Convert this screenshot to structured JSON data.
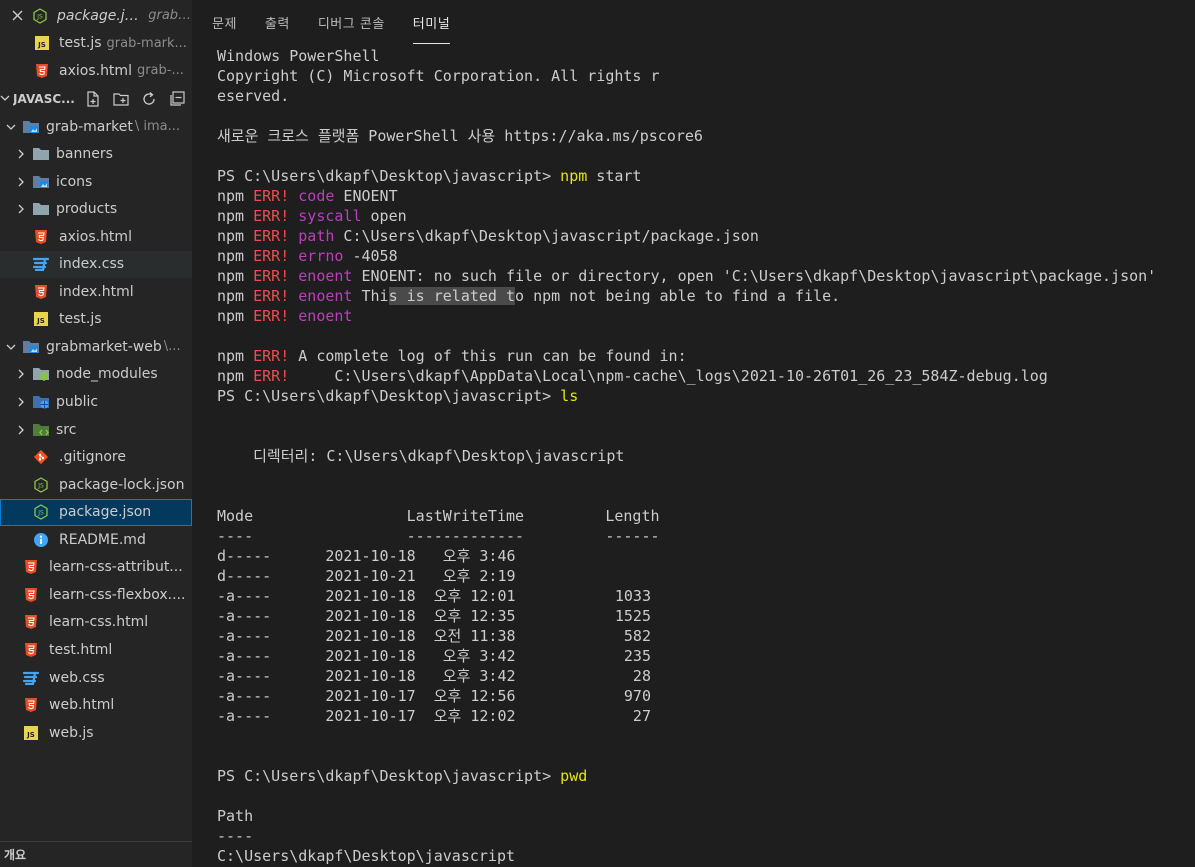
{
  "explorer": {
    "open_editors": [
      {
        "name": "package.json",
        "desc": "grab-...",
        "icon": "node-icon",
        "active": true
      },
      {
        "name": "test.js",
        "desc": "grab-mark...",
        "icon": "js-icon"
      },
      {
        "name": "axios.html",
        "desc": "grab-...",
        "icon": "html-icon"
      }
    ],
    "section_title": "JAVASC...",
    "tree": [
      {
        "name": "grab-market",
        "desc": "\\ ima...",
        "level": 0,
        "type": "folder",
        "icon": "folder-image-icon",
        "expanded": true
      },
      {
        "name": "banners",
        "level": 1,
        "type": "folder",
        "icon": "folder-icon"
      },
      {
        "name": "icons",
        "level": 1,
        "type": "folder",
        "icon": "folder-image-icon"
      },
      {
        "name": "products",
        "level": 1,
        "type": "folder",
        "icon": "folder-icon"
      },
      {
        "name": "axios.html",
        "level": 1,
        "type": "file",
        "icon": "html-icon"
      },
      {
        "name": "index.css",
        "level": 1,
        "type": "file",
        "icon": "css-icon"
      },
      {
        "name": "index.html",
        "level": 1,
        "type": "file",
        "icon": "html-icon"
      },
      {
        "name": "test.js",
        "level": 1,
        "type": "file",
        "icon": "js-icon"
      },
      {
        "name": "grabmarket-web",
        "desc": "\\...",
        "level": 0,
        "type": "folder",
        "icon": "folder-image-icon",
        "expanded": true
      },
      {
        "name": "node_modules",
        "level": 1,
        "type": "folder",
        "icon": "folder-node-icon"
      },
      {
        "name": "public",
        "level": 1,
        "type": "folder",
        "icon": "folder-public-icon"
      },
      {
        "name": "src",
        "level": 1,
        "type": "folder",
        "icon": "folder-src-icon"
      },
      {
        "name": ".gitignore",
        "level": 1,
        "type": "file",
        "icon": "git-icon"
      },
      {
        "name": "package-lock.json",
        "level": 1,
        "type": "file",
        "icon": "node-icon"
      },
      {
        "name": "package.json",
        "level": 1,
        "type": "file",
        "icon": "node-icon",
        "selected": true
      },
      {
        "name": "README.md",
        "level": 1,
        "type": "file",
        "icon": "info-icon"
      },
      {
        "name": "learn-css-attribut...",
        "level": 0,
        "type": "file",
        "icon": "html-icon"
      },
      {
        "name": "learn-css-flexbox....",
        "level": 0,
        "type": "file",
        "icon": "html-icon"
      },
      {
        "name": "learn-css.html",
        "level": 0,
        "type": "file",
        "icon": "html-icon"
      },
      {
        "name": "test.html",
        "level": 0,
        "type": "file",
        "icon": "html-icon"
      },
      {
        "name": "web.css",
        "level": 0,
        "type": "file",
        "icon": "css-icon"
      },
      {
        "name": "web.html",
        "level": 0,
        "type": "file",
        "icon": "html-icon"
      },
      {
        "name": "web.js",
        "level": 0,
        "type": "file",
        "icon": "js-icon"
      }
    ],
    "outline_title": "개요",
    "colors": {
      "html": "#e44d26",
      "css": "#42a5f5",
      "js": "#e8d44d",
      "node": "#8bc34a",
      "git": "#f4511e",
      "info": "#42a5f5",
      "folder": "#90a4ae"
    }
  },
  "panel": {
    "tabs": [
      {
        "label": "문제",
        "active": false
      },
      {
        "label": "출력",
        "active": false
      },
      {
        "label": "디버그 콘솔",
        "active": false
      },
      {
        "label": "터미널",
        "active": true
      }
    ]
  },
  "terminal": {
    "lines": [
      [
        {
          "t": "Windows PowerShell"
        }
      ],
      [
        {
          "t": "Copyright (C) Microsoft Corporation. All rights r"
        }
      ],
      [
        {
          "t": "eserved."
        }
      ],
      [
        {
          "t": ""
        }
      ],
      [
        {
          "t": "새로운 크로스 플랫폼 PowerShell 사용 https://aka.ms/pscore6"
        }
      ],
      [
        {
          "t": ""
        }
      ],
      [
        {
          "t": "PS C:\\Users\\dkapf\\Desktop\\javascript> "
        },
        {
          "t": "npm",
          "c": "cmd"
        },
        {
          "t": " start"
        }
      ],
      [
        {
          "t": "npm "
        },
        {
          "t": "ERR!",
          "c": "err"
        },
        {
          "t": " "
        },
        {
          "t": "code",
          "c": "kw"
        },
        {
          "t": " ENOENT"
        }
      ],
      [
        {
          "t": "npm "
        },
        {
          "t": "ERR!",
          "c": "err"
        },
        {
          "t": " "
        },
        {
          "t": "syscall",
          "c": "kw"
        },
        {
          "t": " open"
        }
      ],
      [
        {
          "t": "npm "
        },
        {
          "t": "ERR!",
          "c": "err"
        },
        {
          "t": " "
        },
        {
          "t": "path",
          "c": "kw"
        },
        {
          "t": " C:\\Users\\dkapf\\Desktop\\javascript/package.json"
        }
      ],
      [
        {
          "t": "npm "
        },
        {
          "t": "ERR!",
          "c": "err"
        },
        {
          "t": " "
        },
        {
          "t": "errno",
          "c": "kw"
        },
        {
          "t": " -4058"
        }
      ],
      [
        {
          "t": "npm "
        },
        {
          "t": "ERR!",
          "c": "err"
        },
        {
          "t": " "
        },
        {
          "t": "enoent",
          "c": "kw"
        },
        {
          "t": " ENOENT: no such file or directory, open 'C:\\Users\\dkapf\\Desktop\\javascript\\package.json'"
        }
      ],
      [
        {
          "t": "npm "
        },
        {
          "t": "ERR!",
          "c": "err"
        },
        {
          "t": " "
        },
        {
          "t": "enoent",
          "c": "kw"
        },
        {
          "t": " Thi"
        },
        {
          "t": "s is related t",
          "c": "hl"
        },
        {
          "t": "o npm not being able to find a file."
        }
      ],
      [
        {
          "t": "npm "
        },
        {
          "t": "ERR!",
          "c": "err"
        },
        {
          "t": " "
        },
        {
          "t": "enoent",
          "c": "kw"
        }
      ],
      [
        {
          "t": ""
        }
      ],
      [
        {
          "t": "npm "
        },
        {
          "t": "ERR!",
          "c": "err"
        },
        {
          "t": " A complete log of this run can be found in:"
        }
      ],
      [
        {
          "t": "npm "
        },
        {
          "t": "ERR!",
          "c": "err"
        },
        {
          "t": "     C:\\Users\\dkapf\\AppData\\Local\\npm-cache\\_logs\\2021-10-26T01_26_23_584Z-debug.log"
        }
      ],
      [
        {
          "t": "PS C:\\Users\\dkapf\\Desktop\\javascript> "
        },
        {
          "t": "ls",
          "c": "cmd"
        }
      ],
      [
        {
          "t": ""
        }
      ],
      [
        {
          "t": ""
        }
      ],
      [
        {
          "t": "    디렉터리: C:\\Users\\dkapf\\Desktop\\javascript"
        }
      ],
      [
        {
          "t": ""
        }
      ],
      [
        {
          "t": ""
        }
      ],
      [
        {
          "t": "Mode                 LastWriteTime         Length"
        }
      ],
      [
        {
          "t": "----                 -------------         ------"
        }
      ],
      [
        {
          "t": "d-----      2021-10-18   오후 3:46"
        }
      ],
      [
        {
          "t": "d-----      2021-10-21   오후 2:19"
        }
      ],
      [
        {
          "t": "-a----      2021-10-18  오후 12:01           1033"
        }
      ],
      [
        {
          "t": "-a----      2021-10-18  오후 12:35           1525"
        }
      ],
      [
        {
          "t": "-a----      2021-10-18  오전 11:38            582"
        }
      ],
      [
        {
          "t": "-a----      2021-10-18   오후 3:42            235"
        }
      ],
      [
        {
          "t": "-a----      2021-10-18   오후 3:42             28"
        }
      ],
      [
        {
          "t": "-a----      2021-10-17  오후 12:56            970"
        }
      ],
      [
        {
          "t": "-a----      2021-10-17  오후 12:02             27"
        }
      ],
      [
        {
          "t": ""
        }
      ],
      [
        {
          "t": ""
        }
      ],
      [
        {
          "t": "PS C:\\Users\\dkapf\\Desktop\\javascript> "
        },
        {
          "t": "pwd",
          "c": "cmd"
        }
      ],
      [
        {
          "t": ""
        }
      ],
      [
        {
          "t": "Path"
        }
      ],
      [
        {
          "t": "----"
        }
      ],
      [
        {
          "t": "C:\\Users\\dkapf\\Desktop\\javascript"
        }
      ]
    ]
  }
}
